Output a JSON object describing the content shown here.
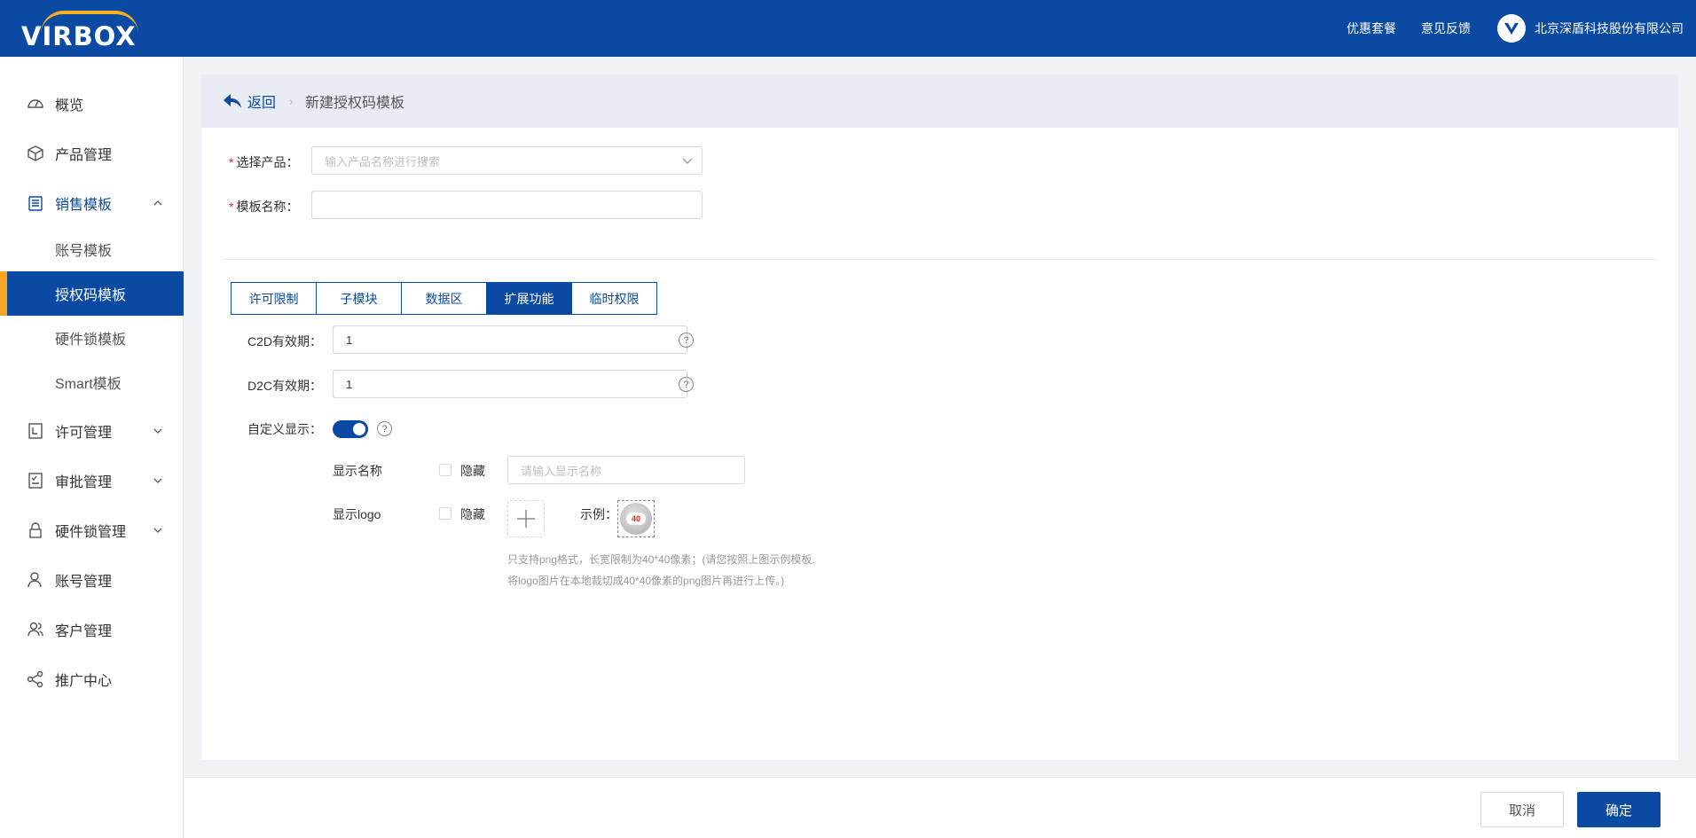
{
  "header": {
    "logo_text": "VIRBOX",
    "links": [
      "优惠套餐",
      "意见反馈"
    ],
    "company": "北京深盾科技股份有限公司"
  },
  "sidebar": {
    "items": [
      {
        "label": "概览",
        "icon": "dashboard-icon"
      },
      {
        "label": "产品管理",
        "icon": "box-icon"
      },
      {
        "label": "销售模板",
        "icon": "clipboard-icon",
        "expanded": true
      },
      {
        "label": "许可管理",
        "icon": "license-icon"
      },
      {
        "label": "审批管理",
        "icon": "checklist-icon"
      },
      {
        "label": "硬件锁管理",
        "icon": "lock-icon"
      },
      {
        "label": "账号管理",
        "icon": "user-icon"
      },
      {
        "label": "客户管理",
        "icon": "users-icon"
      },
      {
        "label": "推广中心",
        "icon": "share-icon"
      }
    ],
    "sub_items": [
      "账号模板",
      "授权码模板",
      "硬件锁模板",
      "Smart模板"
    ],
    "active_sub": "授权码模板"
  },
  "breadcrumb": {
    "back": "返回",
    "current": "新建授权码模板"
  },
  "form": {
    "product_label": "选择产品：",
    "product_placeholder": "输入产品名称进行搜索",
    "template_label": "模板名称：",
    "template_value": ""
  },
  "tabs": [
    "许可限制",
    "子模块",
    "数据区",
    "扩展功能",
    "临时权限"
  ],
  "active_tab": "扩展功能",
  "extension": {
    "c2d_label": "C2D有效期：",
    "c2d_value": "1",
    "d2c_label": "D2C有效期：",
    "d2c_value": "1",
    "custom_display_label": "自定义显示：",
    "custom_display_on": true,
    "display_name_label": "显示名称",
    "hide_label": "隐藏",
    "display_name_placeholder": "请输入显示名称",
    "display_logo_label": "显示logo",
    "example_label": "示例：",
    "example_badge": "40",
    "hint_line1": "只支持png格式，长宽限制为40*40像素；(请您按照上图示例模板,",
    "hint_line2": "将logo图片在本地裁切成40*40像素的png图片再进行上传。)"
  },
  "footer": {
    "cancel": "取消",
    "confirm": "确定"
  },
  "colors": {
    "primary": "#0b4aa2",
    "accent": "#f6a623"
  }
}
